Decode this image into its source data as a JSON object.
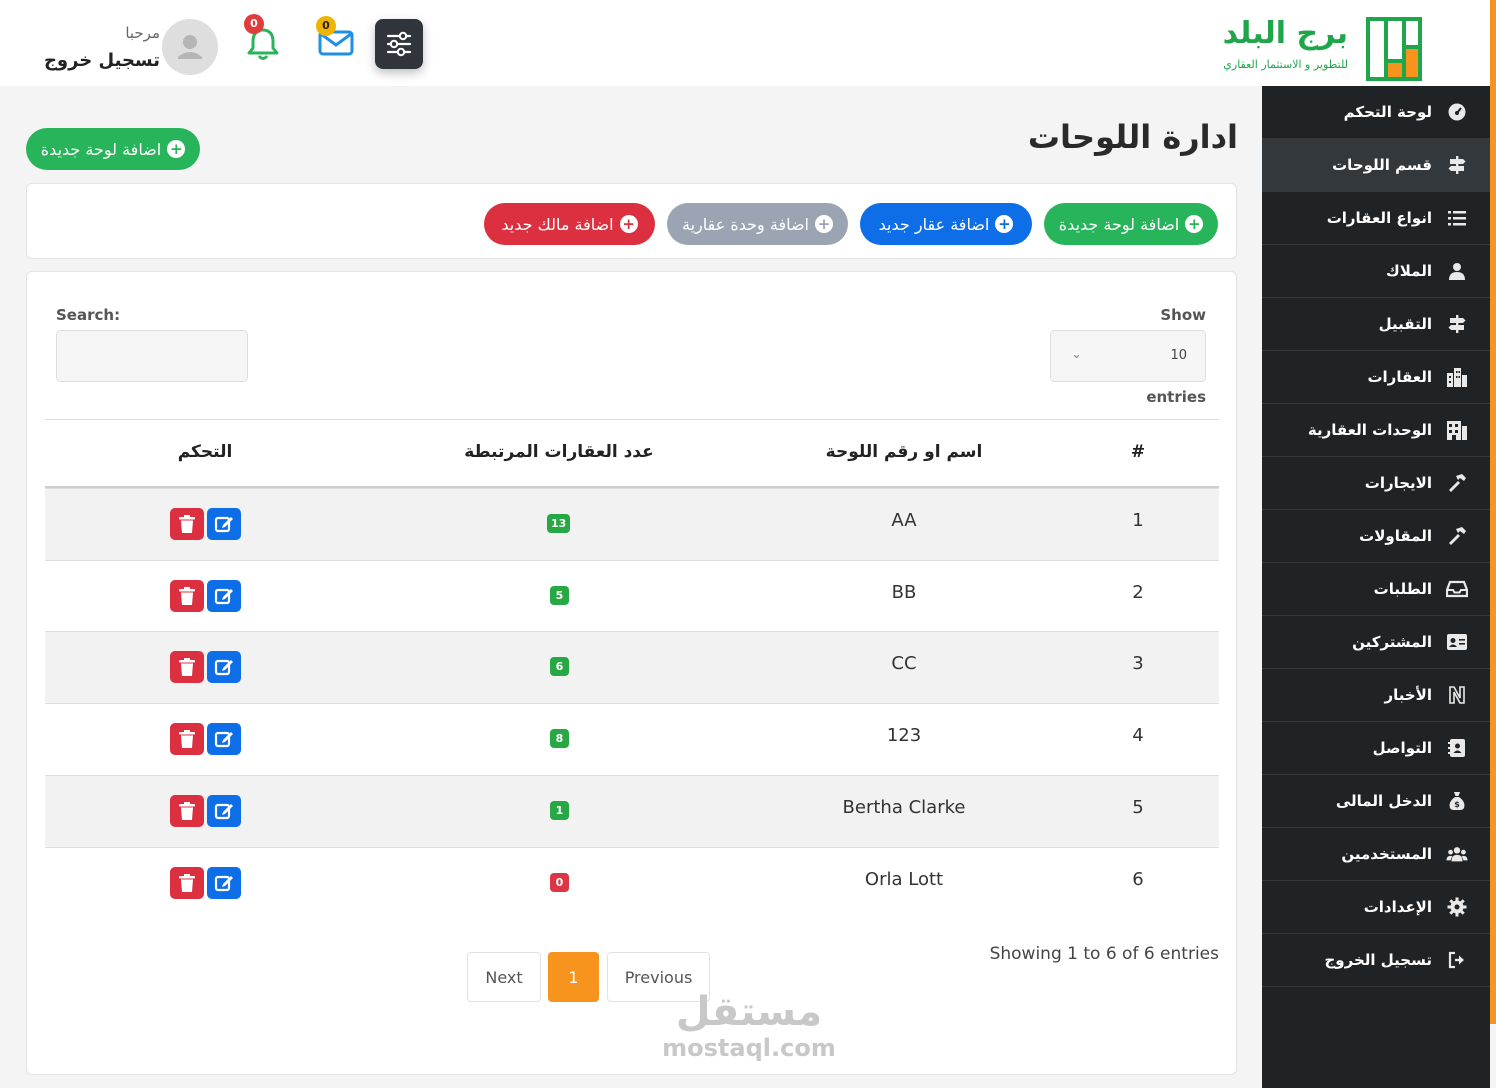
{
  "brand": {
    "name": "برج البلد",
    "tagline": "للتطوير و الاستثمار العقاري",
    "green": "#1fa64a",
    "orange": "#f7941d"
  },
  "header": {
    "welcome": "مرحبا",
    "logout": "تسجيل خروج",
    "mail_count": "0",
    "notif_count": "0"
  },
  "sidebar": {
    "items": [
      {
        "label": "لوحة التحكم",
        "icon": "dashboard-icon"
      },
      {
        "label": "قسم اللوحات",
        "icon": "signpost-icon",
        "active": true
      },
      {
        "label": "انواع العقارات",
        "icon": "list-icon"
      },
      {
        "label": "الملاك",
        "icon": "user-tie-icon"
      },
      {
        "label": "التقبيل",
        "icon": "signpost-icon"
      },
      {
        "label": "العقارات",
        "icon": "city-icon"
      },
      {
        "label": "الوحدات العقارية",
        "icon": "building-icon"
      },
      {
        "label": "الايجارات",
        "icon": "hammer-icon"
      },
      {
        "label": "المقاولات",
        "icon": "hammer-icon"
      },
      {
        "label": "الطلبات",
        "icon": "inbox-icon"
      },
      {
        "label": "المشتركين",
        "icon": "id-card-icon"
      },
      {
        "label": "الأخبار",
        "icon": "news-icon"
      },
      {
        "label": "التواصل",
        "icon": "address-book-icon"
      },
      {
        "label": "الدخل المالى",
        "icon": "money-bag-icon"
      },
      {
        "label": "المستخدمين",
        "icon": "users-icon"
      },
      {
        "label": "الإعدادات",
        "icon": "gear-icon"
      },
      {
        "label": "تسجيل الخروج",
        "icon": "sign-out-icon"
      }
    ]
  },
  "page": {
    "title": "ادارة اللوحات",
    "add_board_button": "اضافة لوحة جديدة",
    "quick_actions": {
      "add_board": "اضافة لوحة جديدة",
      "add_property": "اضافة عقار جديد",
      "add_unit": "اضافة وحدة عقارية",
      "add_owner": "اضافة مالك جديد"
    }
  },
  "table_controls": {
    "show_label": "Show",
    "entries_label": "entries",
    "page_size": "10",
    "search_label": "Search:"
  },
  "table": {
    "headers": {
      "index": "#",
      "name": "اسم او رقم اللوحة",
      "count": "عدد العقارات المرتبطة",
      "actions": "التحكم"
    },
    "rows": [
      {
        "index": "1",
        "name": "AA",
        "count": "13",
        "count_color": "#28a745"
      },
      {
        "index": "2",
        "name": "BB",
        "count": "5",
        "count_color": "#28a745"
      },
      {
        "index": "3",
        "name": "CC",
        "count": "6",
        "count_color": "#28a745"
      },
      {
        "index": "4",
        "name": "123",
        "count": "8",
        "count_color": "#28a745"
      },
      {
        "index": "5",
        "name": "Bertha Clarke",
        "count": "1",
        "count_color": "#28a745"
      },
      {
        "index": "6",
        "name": "Orla Lott",
        "count": "0",
        "count_color": "#dc3545"
      }
    ]
  },
  "pagination": {
    "info": "Showing 1 to 6 of 6 entries",
    "previous": "Previous",
    "current": "1",
    "next": "Next"
  },
  "watermark": {
    "arabic": "مستقل",
    "latin": "mostaql.com"
  }
}
